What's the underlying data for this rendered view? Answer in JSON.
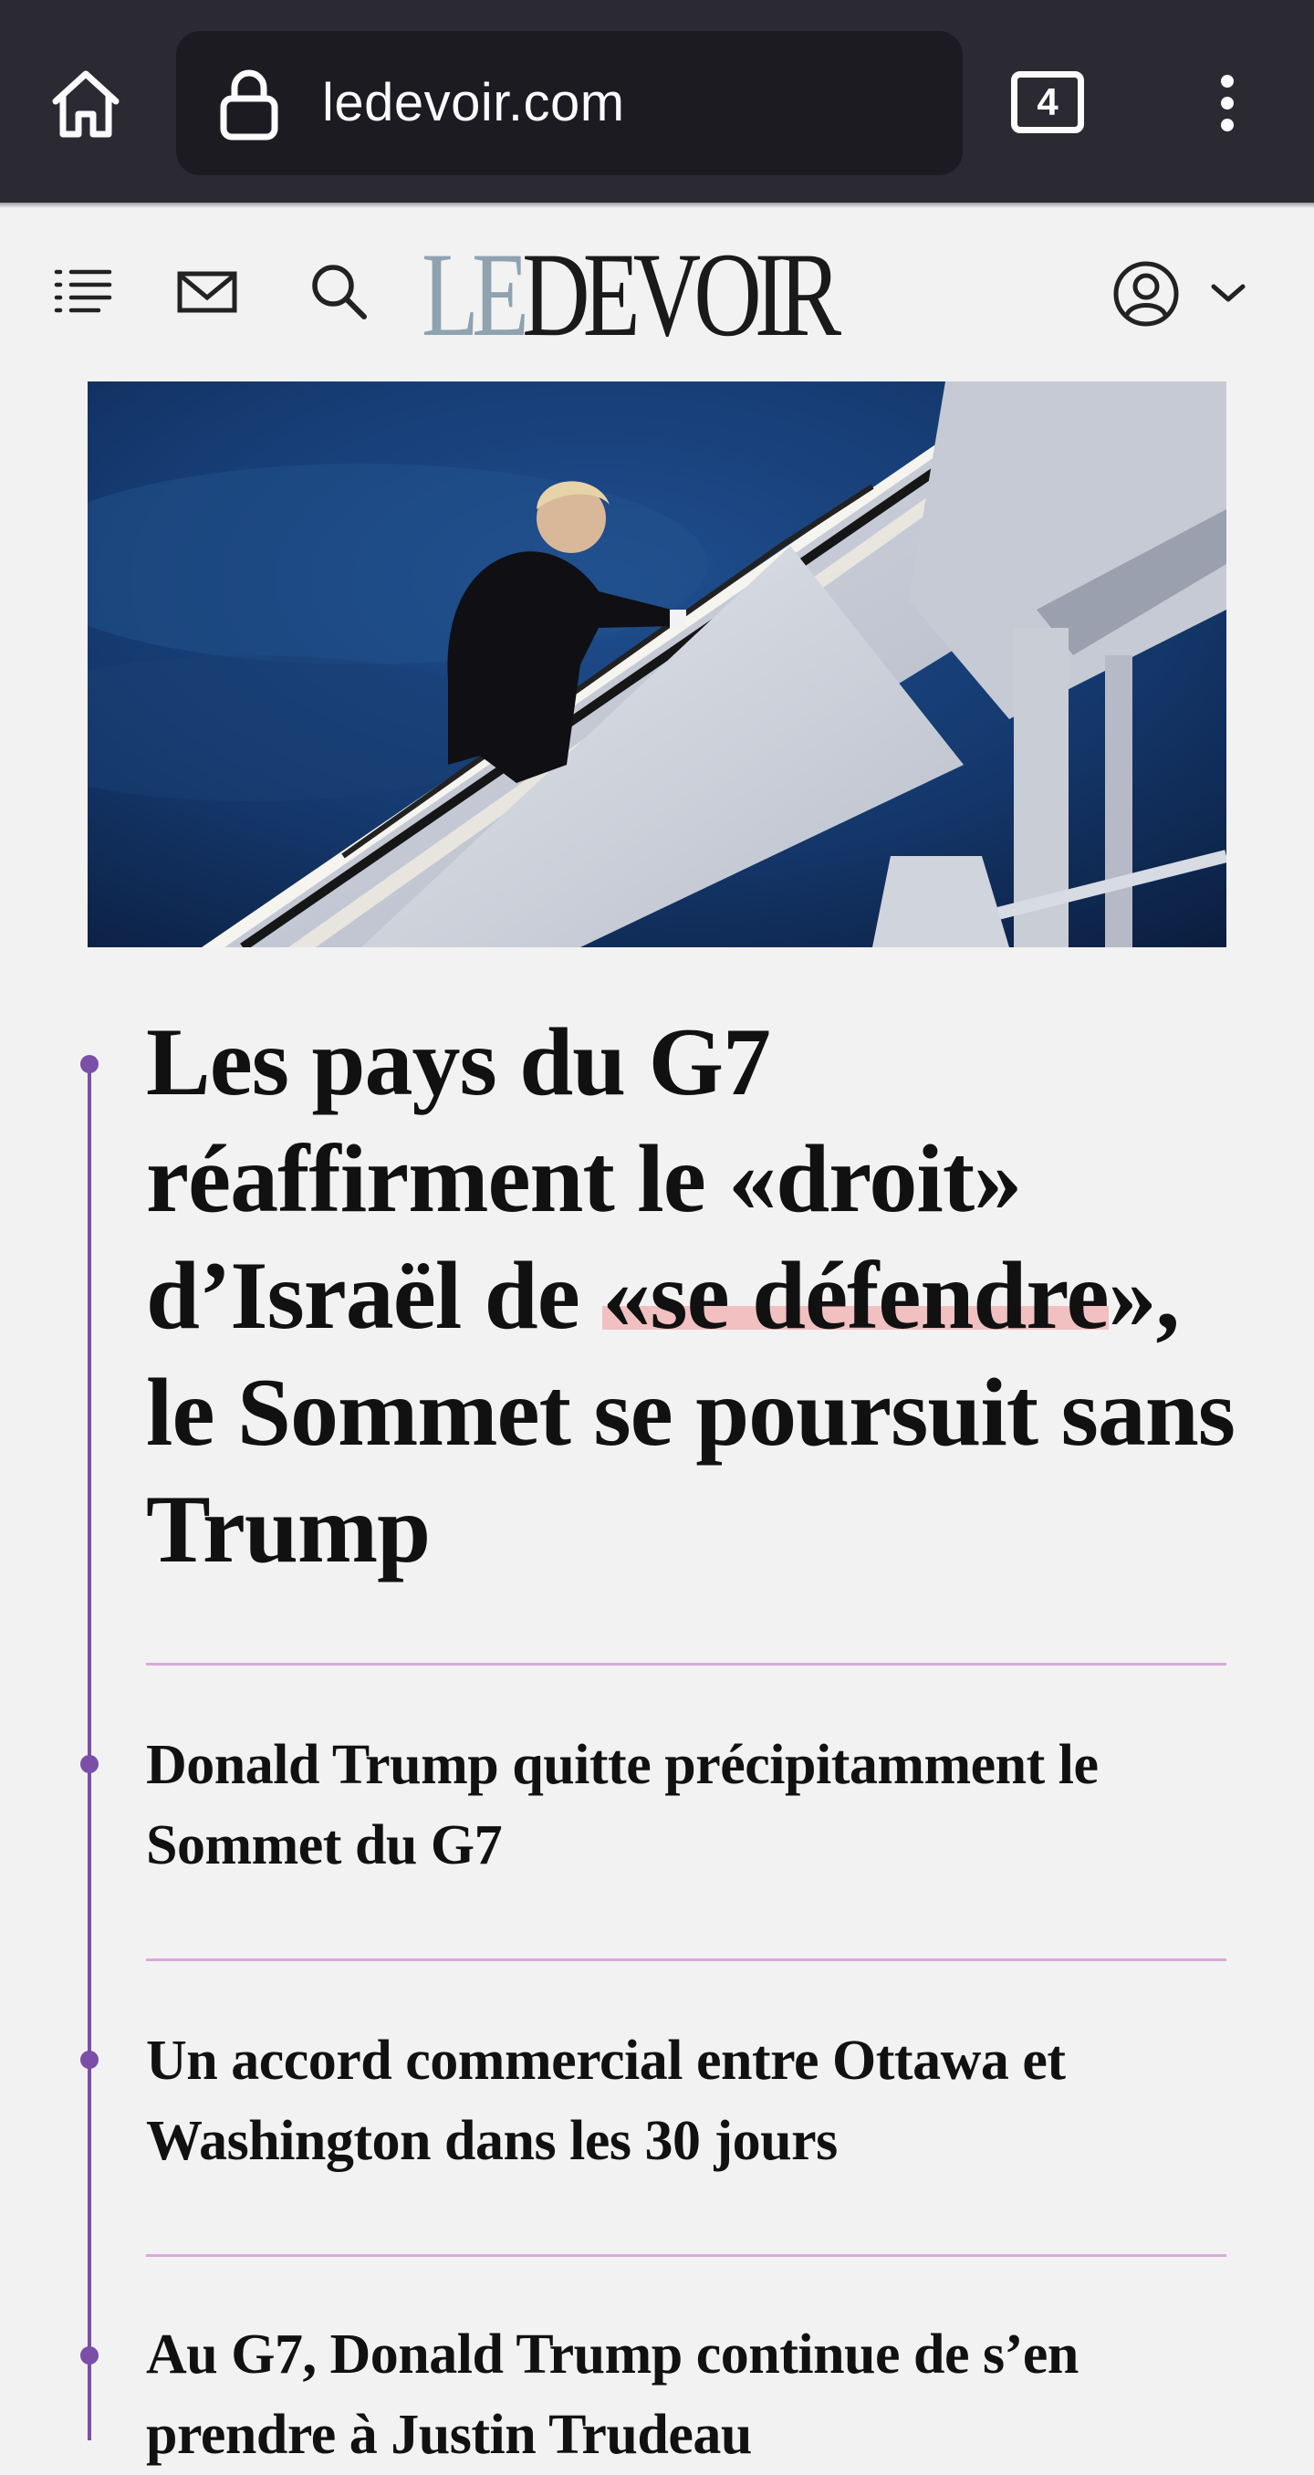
{
  "browser": {
    "url": "ledevoir.com",
    "tab_count": "4",
    "icons": [
      "home-icon",
      "lock-icon",
      "tabs-icon",
      "more-vert-icon"
    ]
  },
  "header": {
    "logo_le": "LE",
    "logo_devoir": "DEVOIR",
    "icons": [
      "list-menu-icon",
      "mail-icon",
      "search-icon",
      "account-icon",
      "chevron-down-icon"
    ]
  },
  "article": {
    "headline_before": "Les pays du G7 réaffirment le «droit» d’Israël de ",
    "headline_highlight": "«se défendre",
    "headline_after": "», le Sommet se poursuit sans Trump",
    "related": [
      {
        "title": "Donald Trump quitte précipitamment le Sommet du G7"
      },
      {
        "title": "Un accord commercial entre Ottawa et Washington dans les 30 jours"
      },
      {
        "title": "Au G7, Donald Trump continue de s’en prendre à Justin Trudeau"
      }
    ]
  },
  "colors": {
    "browser_bg": "#2b2a33",
    "url_bar_bg": "#1c1b22",
    "page_bg": "#f2f2f2",
    "accent_purple": "#7b4fa8",
    "divider": "#d9a9d9",
    "logo_le": "#8ea2b0",
    "highlight": "#f09696"
  }
}
